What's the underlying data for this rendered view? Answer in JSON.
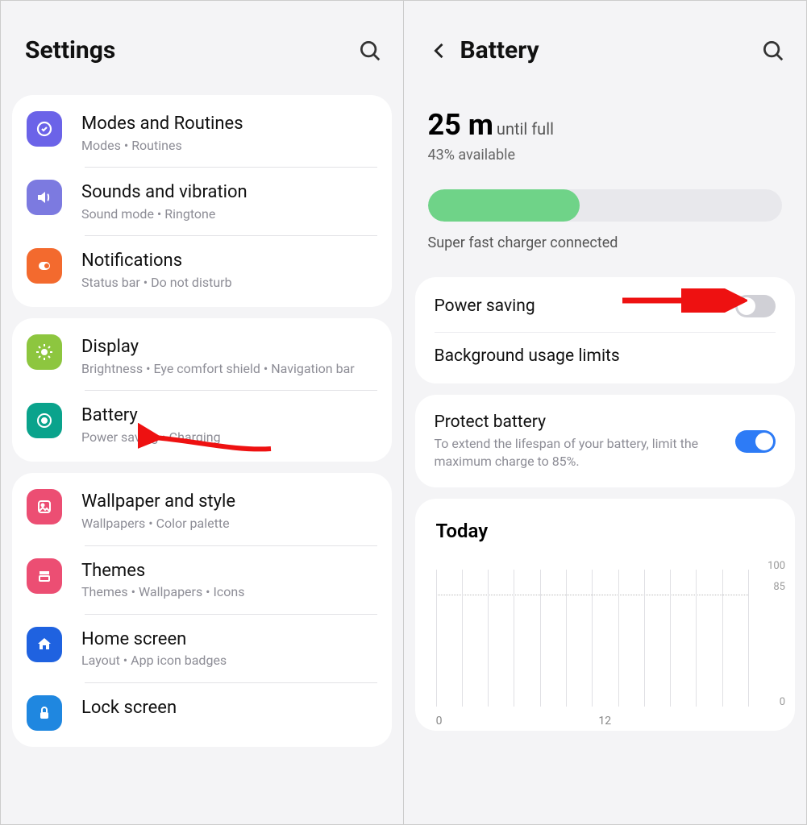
{
  "left": {
    "title": "Settings",
    "groups": [
      [
        {
          "icon": "modes",
          "color": "#6b63e8",
          "label": "Modes and Routines",
          "sub": "Modes  •  Routines"
        },
        {
          "icon": "sound",
          "color": "#7c7ae0",
          "label": "Sounds and vibration",
          "sub": "Sound mode  •  Ringtone"
        },
        {
          "icon": "notif",
          "color": "#f36a2e",
          "label": "Notifications",
          "sub": "Status bar  •  Do not disturb"
        }
      ],
      [
        {
          "icon": "display",
          "color": "#8dc63f",
          "label": "Display",
          "sub": "Brightness  •  Eye comfort shield  •  Navigation bar"
        },
        {
          "icon": "battery",
          "color": "#0aa38c",
          "label": "Battery",
          "sub": "Power saving  •  Charging"
        }
      ],
      [
        {
          "icon": "wallpaper",
          "color": "#ec4e73",
          "label": "Wallpaper and style",
          "sub": "Wallpapers  •  Color palette"
        },
        {
          "icon": "themes",
          "color": "#ec4e73",
          "label": "Themes",
          "sub": "Themes  •  Wallpapers  •  Icons"
        },
        {
          "icon": "home",
          "color": "#1f62e0",
          "label": "Home screen",
          "sub": "Layout  •  App icon badges"
        },
        {
          "icon": "lock",
          "color": "#1f87e0",
          "label": "Lock screen",
          "sub": ""
        }
      ]
    ]
  },
  "right": {
    "title": "Battery",
    "time_value": "25 m",
    "time_suffix": "until full",
    "percent_text": "43% available",
    "percent_fill": 43,
    "charger_note": "Super fast charger connected",
    "options1": [
      {
        "label": "Power saving",
        "toggle": "off"
      },
      {
        "label": "Background usage limits"
      }
    ],
    "protect": {
      "label": "Protect battery",
      "sub": "To extend the lifespan of your battery, limit the maximum charge to 85%.",
      "toggle": "on"
    },
    "today_label": "Today"
  },
  "chart_data": {
    "type": "line",
    "title": "Today",
    "xlabel": "",
    "ylabel": "",
    "ylim": [
      0,
      100
    ],
    "y_ticks": [
      0,
      85,
      100
    ],
    "x_ticks": [
      "0",
      "12"
    ],
    "x_range_hours": [
      0,
      24
    ],
    "series": []
  }
}
